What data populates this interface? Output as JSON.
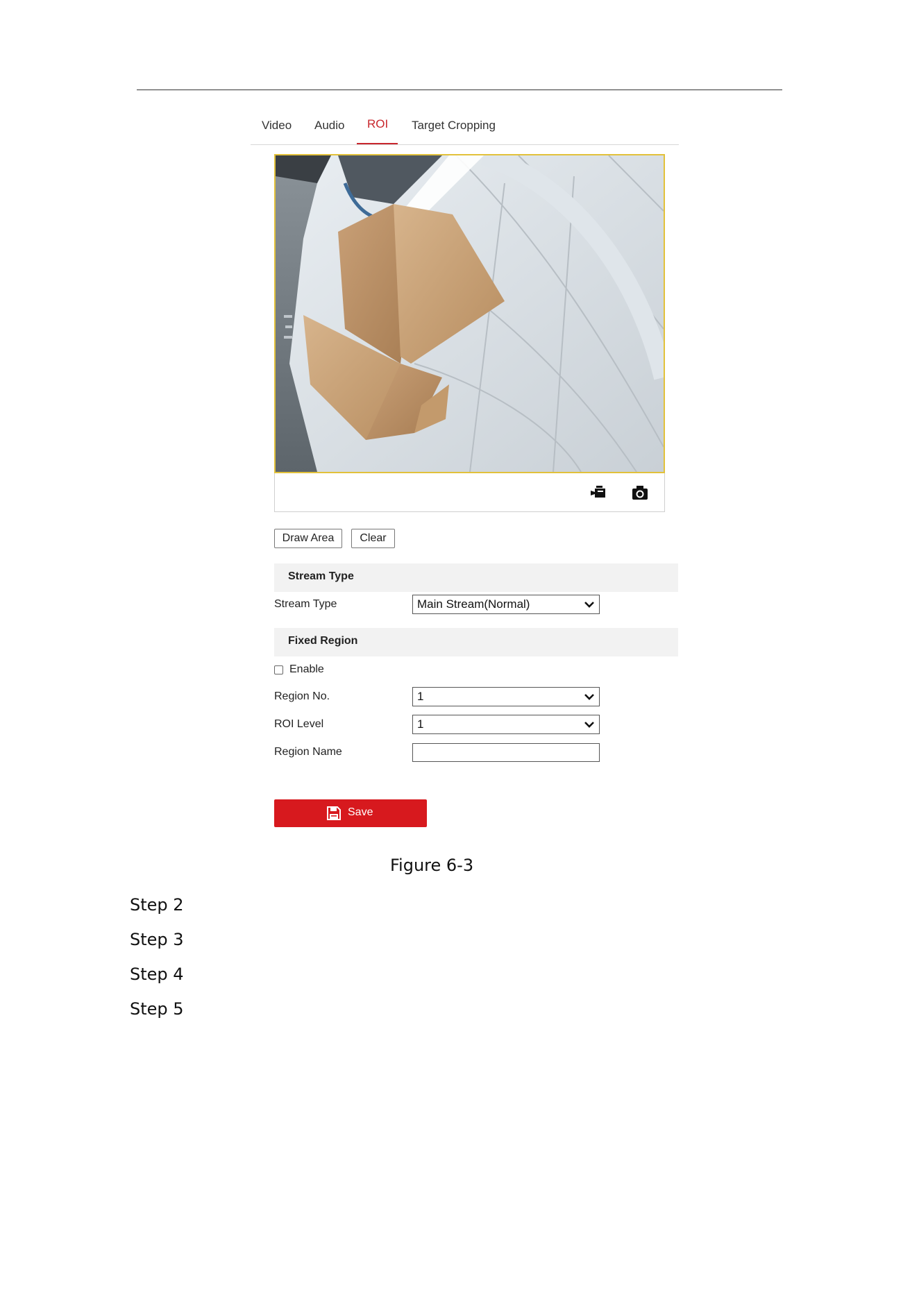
{
  "tabs": [
    {
      "label": "Video"
    },
    {
      "label": "Audio"
    },
    {
      "label": "ROI",
      "active": true
    },
    {
      "label": "Target Cropping"
    }
  ],
  "video": {
    "toolbar_icons": [
      "record-icon",
      "snapshot-icon"
    ]
  },
  "buttons": {
    "draw_area": "Draw Area",
    "clear": "Clear",
    "save": "Save"
  },
  "stream_section": {
    "title": "Stream Type",
    "stream_type_label": "Stream Type",
    "stream_type_value": "Main Stream(Normal)"
  },
  "fixed_region": {
    "title": "Fixed Region",
    "enable_label": "Enable",
    "enable_checked": false,
    "region_no_label": "Region No.",
    "region_no_value": "1",
    "roi_level_label": "ROI Level",
    "roi_level_value": "1",
    "region_name_label": "Region Name",
    "region_name_value": ""
  },
  "caption": "Figure 6-3",
  "steps": [
    "Step 2",
    "Step 3",
    "Step 4",
    "Step 5"
  ],
  "colors": {
    "accent": "#c8262c",
    "save_button": "#d7191e",
    "video_border": "#e2c13a",
    "section_bg": "#f2f2f2"
  }
}
